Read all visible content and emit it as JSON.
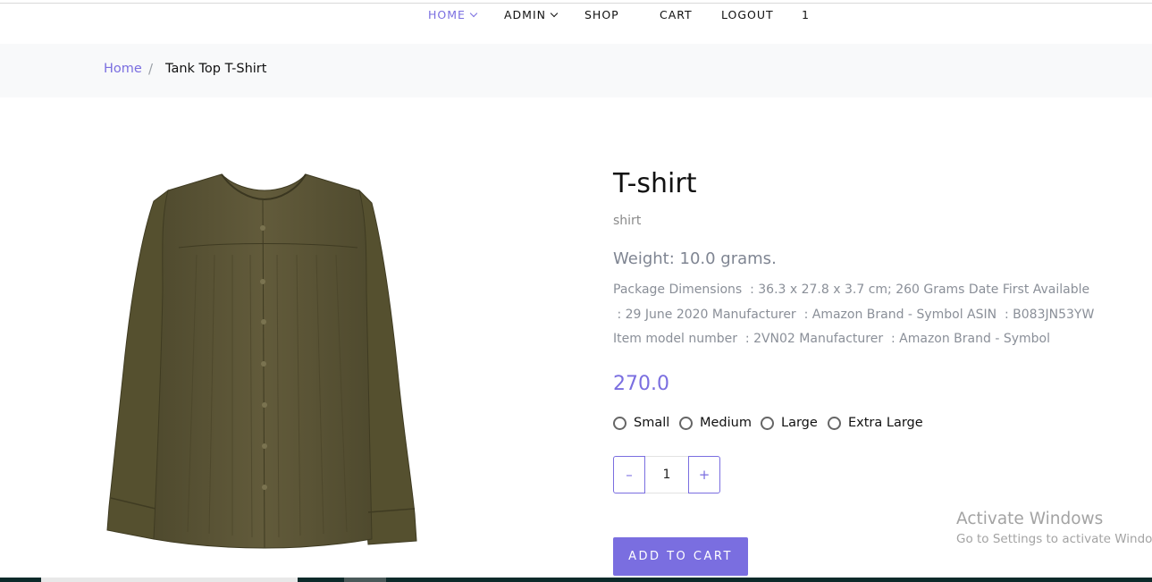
{
  "nav": {
    "items": [
      {
        "label": "HOME",
        "active": true,
        "has_dropdown": true
      },
      {
        "label": "ADMIN",
        "active": false,
        "has_dropdown": true
      },
      {
        "label": "SHOP",
        "active": false,
        "has_dropdown": false
      },
      {
        "label": "CART",
        "active": false,
        "has_dropdown": false
      },
      {
        "label": "LOGOUT",
        "active": false,
        "has_dropdown": false
      },
      {
        "label": "1",
        "active": false,
        "has_dropdown": false
      }
    ]
  },
  "breadcrumb": {
    "home": "Home",
    "separator": "/",
    "current": "Tank Top T-Shirt"
  },
  "product": {
    "title": "T-shirt",
    "category": "shirt",
    "weight": "Weight: 10.0 grams.",
    "description": "Package Dimensions  : 36.3 x 27.8 x 3.7 cm; 260 Grams Date First Available  : 29 June 2020 Manufacturer  : Amazon Brand - Symbol ASIN  : B083JN53YW Item model number  : 2VN02 Manufacturer  : Amazon Brand - Symbol",
    "price": "270.0",
    "sizes": [
      "Small",
      "Medium",
      "Large",
      "Extra Large"
    ],
    "quantity": {
      "minus": "–",
      "value": "1",
      "plus": "+"
    },
    "add_to_cart": "ADD TO CART",
    "image_icon": "shirt-image"
  },
  "watermark": {
    "title": "Activate Windows",
    "subtitle": "Go to Settings to activate Windows."
  },
  "colors": {
    "accent": "#7a6ee0",
    "breadcrumb_bg": "#f8f9fa",
    "shirt": "#5b5436",
    "muted_text": "#8a8f98"
  }
}
